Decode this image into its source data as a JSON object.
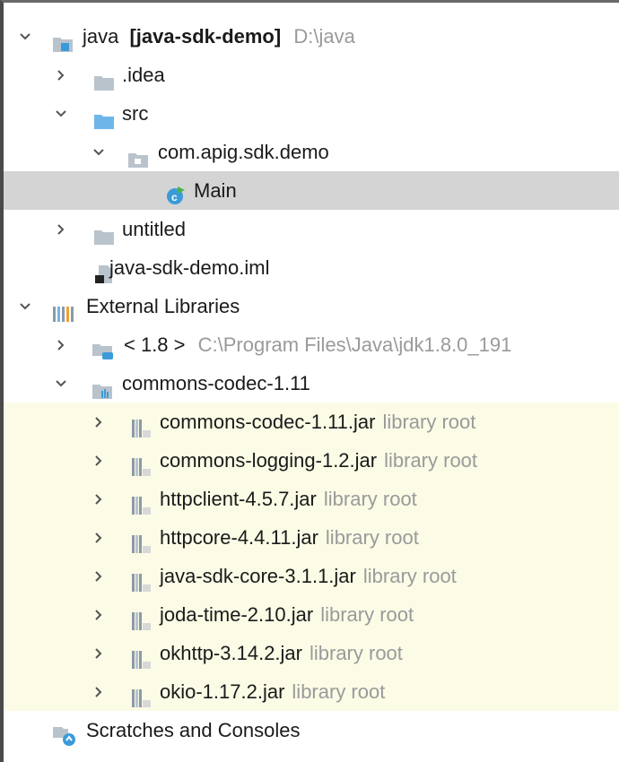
{
  "tree": {
    "project": {
      "name": "java",
      "module": "[java-sdk-demo]",
      "path": "D:\\java"
    },
    "idea": ".idea",
    "src": "src",
    "package": "com.apig.sdk.demo",
    "main_class": "Main",
    "untitled": "untitled",
    "iml": "java-sdk-demo.iml",
    "external_libraries": "External Libraries",
    "jdk": {
      "name": "< 1.8 >",
      "path": "C:\\Program Files\\Java\\jdk1.8.0_191"
    },
    "codec_lib": "commons-codec-1.11",
    "jars": [
      {
        "name": "commons-codec-1.11.jar",
        "suffix": "library root"
      },
      {
        "name": "commons-logging-1.2.jar",
        "suffix": "library root"
      },
      {
        "name": "httpclient-4.5.7.jar",
        "suffix": "library root"
      },
      {
        "name": "httpcore-4.4.11.jar",
        "suffix": "library root"
      },
      {
        "name": "java-sdk-core-3.1.1.jar",
        "suffix": "library root"
      },
      {
        "name": "joda-time-2.10.jar",
        "suffix": "library root"
      },
      {
        "name": "okhttp-3.14.2.jar",
        "suffix": "library root"
      },
      {
        "name": "okio-1.17.2.jar",
        "suffix": "library root"
      }
    ],
    "scratches": "Scratches and Consoles"
  },
  "colors": {
    "selected_bg": "#d4d4d4",
    "library_bg": "#fcfbe6",
    "folder": "#b9c3cc",
    "source_folder": "#6fb6e8",
    "class_icon": "#3b9bd9",
    "muted_text": "#9a9a9a"
  },
  "icons": {
    "project": "project-folder-icon",
    "folder": "folder-icon",
    "source_folder": "source-folder-icon",
    "package": "package-icon",
    "class": "java-class-icon",
    "module_file": "module-file-icon",
    "libraries": "libraries-icon",
    "jdk": "jdk-icon",
    "library": "library-icon",
    "jar": "jar-icon",
    "scratches": "scratches-icon"
  }
}
